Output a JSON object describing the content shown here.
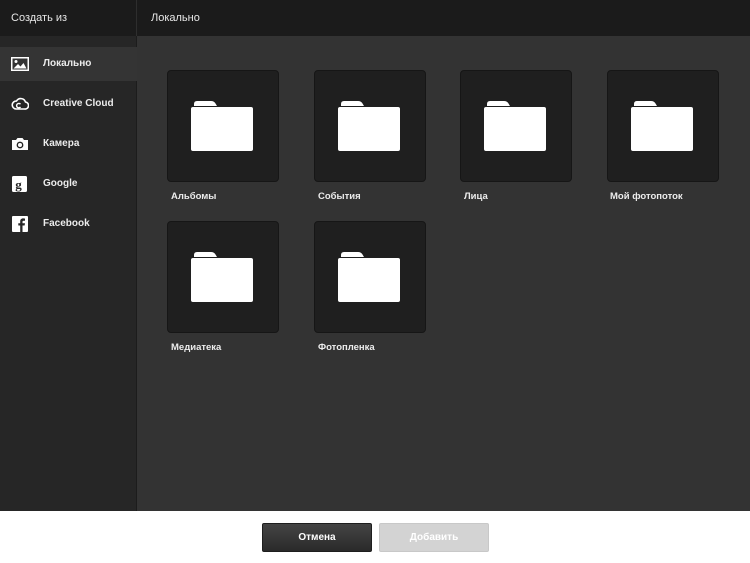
{
  "header": {
    "left_title": "Создать из",
    "right_title": "Локально"
  },
  "sidebar": {
    "items": [
      {
        "label": "Локально",
        "icon": "image-icon",
        "selected": true
      },
      {
        "label": "Creative Cloud",
        "icon": "creative-cloud-icon",
        "selected": false
      },
      {
        "label": "Камера",
        "icon": "camera-icon",
        "selected": false
      },
      {
        "label": "Google",
        "icon": "google-icon",
        "selected": false
      },
      {
        "label": "Facebook",
        "icon": "facebook-icon",
        "selected": false
      }
    ]
  },
  "main": {
    "folders": [
      {
        "label": "Альбомы",
        "icon": "folder-icon"
      },
      {
        "label": "События",
        "icon": "folder-icon"
      },
      {
        "label": "Лица",
        "icon": "folder-icon"
      },
      {
        "label": "Мой фотопоток",
        "icon": "folder-icon"
      },
      {
        "label": "Медиатека",
        "icon": "folder-icon"
      },
      {
        "label": "Фотопленка",
        "icon": "folder-icon"
      }
    ]
  },
  "footer": {
    "cancel_label": "Отмена",
    "add_label": "Добавить"
  },
  "colors": {
    "header_bg": "#1b1b1b",
    "sidebar_bg": "#262626",
    "selected_bg": "#343434",
    "main_bg": "#333333",
    "tile_bg": "#1f1f1f",
    "disabled_button": "#d3d3d3"
  }
}
